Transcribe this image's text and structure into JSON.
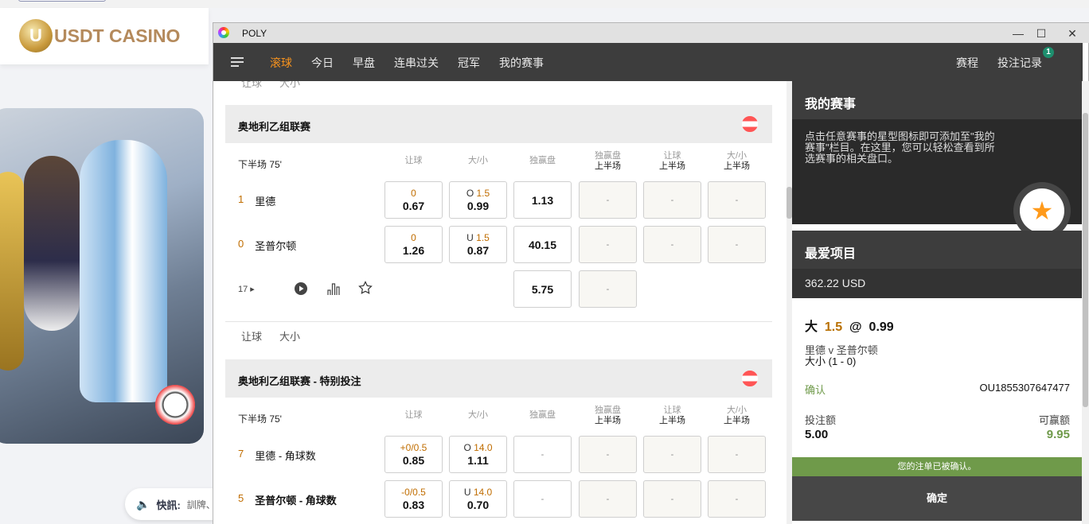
{
  "site": {
    "logo_text": "USDT CASINO",
    "logo_badge": "U",
    "ticker_label": "快訊:",
    "ticker_text": "訓牌、"
  },
  "window": {
    "title": "POLY",
    "minimize": "—",
    "maximize": "☐",
    "close": "✕"
  },
  "nav": {
    "items": [
      "滚球",
      "今日",
      "早盘",
      "连串过关",
      "冠军",
      "我的赛事"
    ],
    "active": 0,
    "schedule": "赛程",
    "bet_history": "投注记录",
    "bet_history_badge": "1"
  },
  "tabs": {
    "handicap": "让球",
    "over_under": "大小"
  },
  "columns": [
    {
      "top": "让球",
      "bottom": ""
    },
    {
      "top": "大/小",
      "bottom": ""
    },
    {
      "top": "独赢盘",
      "bottom": ""
    },
    {
      "top": "独赢盘",
      "bottom": "上半场"
    },
    {
      "top": "让球",
      "bottom": "上半场"
    },
    {
      "top": "大/小",
      "bottom": "上半场"
    }
  ],
  "leagues": [
    {
      "name": "奥地利乙组联赛",
      "period": "下半场 75'",
      "teams": [
        {
          "score": "1",
          "name": "里德",
          "cells": [
            {
              "hd": "0",
              "od": "0.67"
            },
            {
              "pf": "O",
              "hd": "1.5",
              "od": "0.99"
            },
            {
              "od": "1.13"
            },
            {
              "dash": "-"
            },
            {
              "dash": "-"
            },
            {
              "dash": "-"
            }
          ]
        },
        {
          "score": "0",
          "name": "圣普尔顿",
          "cells": [
            {
              "hd": "0",
              "od": "1.26"
            },
            {
              "pf": "U",
              "hd": "1.5",
              "od": "0.87"
            },
            {
              "od": "40.15"
            },
            {
              "dash": "-"
            },
            {
              "dash": "-"
            },
            {
              "dash": "-"
            }
          ]
        }
      ],
      "draw": {
        "od": "5.75",
        "half": "-"
      },
      "more_count": "17"
    },
    {
      "name": "奥地利乙组联赛 - 特别投注",
      "period": "下半场 75'",
      "teams": [
        {
          "score": "7",
          "name": "里德 - 角球数",
          "cells": [
            {
              "hd": "+0/0.5",
              "od": "0.85"
            },
            {
              "pf": "O",
              "hd": "14.0",
              "od": "1.11"
            },
            {
              "dash": "-"
            },
            {
              "dash": "-"
            },
            {
              "dash": "-"
            },
            {
              "dash": "-"
            }
          ]
        },
        {
          "score": "5",
          "name": "圣普尔顿 - 角球数",
          "cells": [
            {
              "hd": "-0/0.5",
              "od": "0.83"
            },
            {
              "pf": "U",
              "hd": "14.0",
              "od": "0.70"
            },
            {
              "dash": "-"
            },
            {
              "dash": "-"
            },
            {
              "dash": "-"
            },
            {
              "dash": "-"
            }
          ]
        }
      ]
    }
  ],
  "right": {
    "my_events_title": "我的赛事",
    "my_events_info": "点击任意赛事的星型图标即可添加至\"我的赛事\"栏目。在这里，您可以轻松查看到所选赛事的相关盘口。",
    "favorites_title": "最爱项目",
    "balance": "362.22 USD",
    "bet": {
      "selection": "大",
      "handicap": "1.5",
      "at": "@",
      "odds": "0.99",
      "match": "里德 v 圣普尔顿",
      "market": "大小 (1 - 0)",
      "status": "确认",
      "ref": "OU1855307647477",
      "stake_label": "投注额",
      "stake": "5.00",
      "win_label": "可赢额",
      "win": "9.95"
    },
    "confirmed_msg": "您的注单已被确认。",
    "ok_button": "确定"
  },
  "colors": {
    "accent": "#f7931e",
    "odds_orange": "#c06d00",
    "green": "#6f9a4a",
    "nav_bg": "#3d3d3d"
  }
}
